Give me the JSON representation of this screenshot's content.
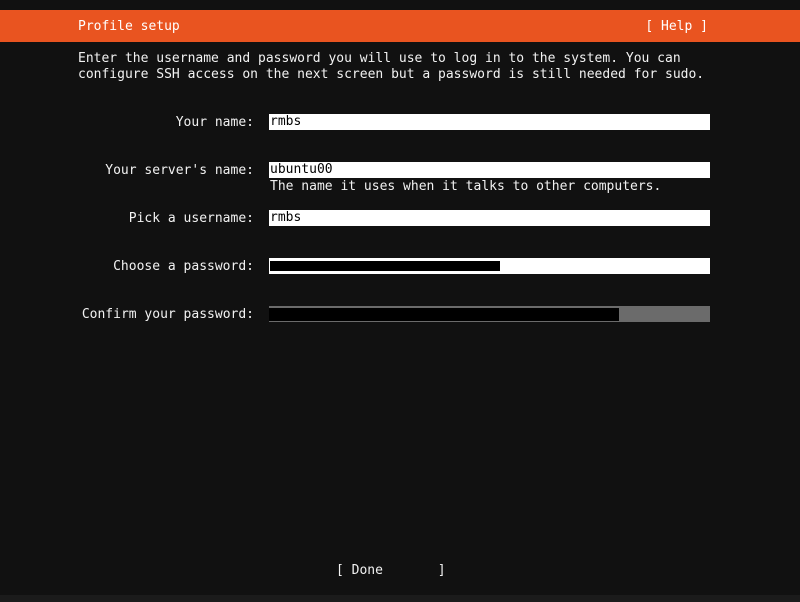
{
  "header": {
    "title": "Profile setup",
    "help_label": "[ Help ]"
  },
  "intro_text": "Enter the username and password you will use to log in to the system. You can configure SSH access on the next screen but a password is still needed for sudo.",
  "form": {
    "your_name": {
      "label": "Your name:",
      "value": "rmbs"
    },
    "server_name": {
      "label": "Your server's name:",
      "value": "ubuntu00",
      "hint": "The name it uses when it talks to other computers."
    },
    "username": {
      "label": "Pick a username:",
      "value": "rmbs"
    },
    "password": {
      "label": "Choose a password:",
      "masked": true
    },
    "confirm_password": {
      "label": "Confirm your password:",
      "masked": true
    }
  },
  "done_label": "[ Done       ]",
  "colors": {
    "accent": "#e95420",
    "background": "#111111",
    "field_bg": "#ffffff",
    "focused_field_bg": "#6b6b6b"
  }
}
